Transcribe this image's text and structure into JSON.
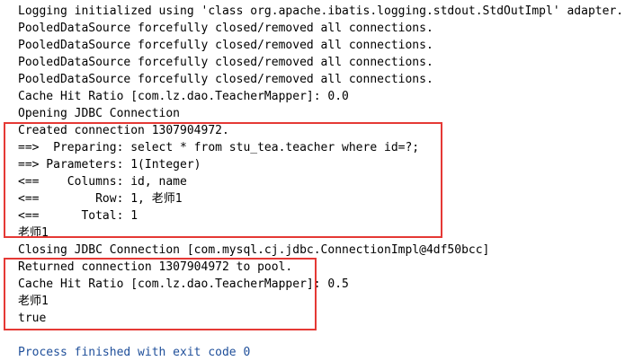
{
  "console": {
    "lines": [
      "Logging initialized using 'class org.apache.ibatis.logging.stdout.StdOutImpl' adapter.",
      "PooledDataSource forcefully closed/removed all connections.",
      "PooledDataSource forcefully closed/removed all connections.",
      "PooledDataSource forcefully closed/removed all connections.",
      "PooledDataSource forcefully closed/removed all connections.",
      "Cache Hit Ratio [com.lz.dao.TeacherMapper]: 0.0",
      "Opening JDBC Connection",
      "Created connection 1307904972.",
      "==>  Preparing: select * from stu_tea.teacher where id=?;",
      "==> Parameters: 1(Integer)",
      "<==    Columns: id, name",
      "<==        Row: 1, 老师1",
      "<==      Total: 1",
      "老师1",
      "Closing JDBC Connection [com.mysql.cj.jdbc.ConnectionImpl@4df50bcc]",
      "Returned connection 1307904972 to pool.",
      "Cache Hit Ratio [com.lz.dao.TeacherMapper]: 0.5",
      "老师1",
      "true",
      "",
      "Process finished with exit code 0"
    ]
  },
  "colors": {
    "background": "#ffffff",
    "text": "#000000",
    "exit_text": "#1f4f9a",
    "highlight": "#e53935"
  }
}
